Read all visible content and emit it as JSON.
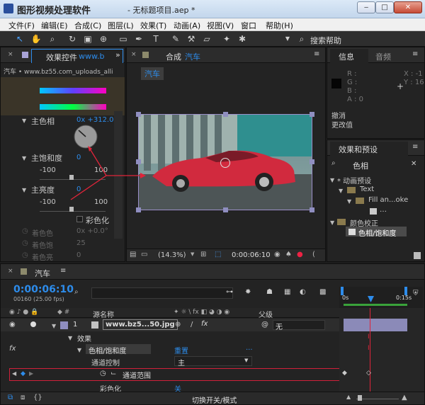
{
  "window": {
    "title_text": "图形视频处理软件",
    "doc_title": "- 无标题项目.aep *",
    "minimize": "‒",
    "maximize": "□",
    "close": "✕"
  },
  "menu": [
    "文件(F)",
    "编辑(E)",
    "合成(C)",
    "图层(L)",
    "效果(T)",
    "动画(A)",
    "视图(V)",
    "窗口",
    "帮助(H)"
  ],
  "toolbar": {
    "search_label": "搜索帮助"
  },
  "effect_controls": {
    "tab_label": "效果控件",
    "tab_suffix": "www.b",
    "path": "汽车 • www.bz55.com_uploads_alli",
    "hue_label": "主色相",
    "hue_value": "0x +312.0",
    "sat_label": "主饱和度",
    "sat_value": "0",
    "sat_min": "-100",
    "sat_max": "100",
    "light_label": "主亮度",
    "light_value": "0",
    "light_min": "-100",
    "light_max": "100",
    "colorize_label": "彩色化",
    "colorize_hue_label": "着色色",
    "colorize_hue_value": "0x +0.0°",
    "colorize_sat_label": "着色饱",
    "colorize_sat_value": "25",
    "colorize_light_label": "着色亮",
    "colorize_light_value": "0"
  },
  "composition": {
    "tab_label": "合成",
    "tab_name": "汽车",
    "comp_button": "汽车",
    "zoom": "(14.3%)",
    "timecode": "0:00:06:10"
  },
  "info": {
    "tab_info": "信息",
    "tab_audio": "音频",
    "r": "R :",
    "g": "G :",
    "b": "B :",
    "a": "A : 0",
    "x": "X : -1",
    "y": "Y : 16",
    "undo1": "撤消",
    "undo2": "更改值"
  },
  "effects_presets": {
    "tab_label": "效果和预设",
    "search_value": "色相",
    "items": [
      "* 动画预设",
      "Text",
      "Fill an...oke",
      "…",
      "颜色校正",
      "色相/饱和度"
    ]
  },
  "timeline": {
    "tab_label": "汽车",
    "timecode": "0:00:06:10",
    "fps": "00160 (25.00 fps)",
    "col_source": "源名称",
    "col_parent": "父级",
    "layer_num": "1",
    "layer_name": "www.bz5...50.jpg",
    "parent_value": "无",
    "effects_label": "效果",
    "effect_name": "色相/饱和度",
    "reset_label": "重置",
    "channel_ctrl_label": "通道控制",
    "channel_ctrl_value": "主",
    "channel_range_label": "通道范围",
    "colorize_label": "彩色化",
    "colorize_value": "关",
    "fx_label": "fx",
    "switch_mode": "切换开关/模式",
    "ruler_start": "0s",
    "ruler_end": "0:15s"
  }
}
